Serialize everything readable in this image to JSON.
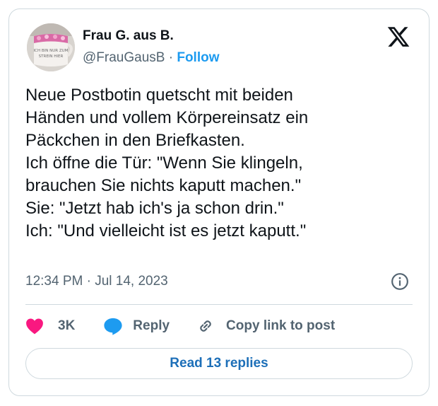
{
  "author": {
    "name": "Frau G. aus B.",
    "handle": "@FrauGausB",
    "separator": "·",
    "follow_label": "Follow",
    "avatar_icon": "avatar-mug-photo",
    "avatar_text": "ICH BIN NUR ZUM\nSTREIN HIER"
  },
  "platform_icon": "x-logo-icon",
  "tweet": {
    "text": "Neue Postbotin quetscht mit beiden\nHänden und vollem Körpereinsatz ein\nPäckchen in den Briefkasten.\nIch öffne die Tür: \"Wenn Sie klingeln,\nbrauchen Sie nichts kaputt machen.\"\nSie: \"Jetzt hab ich's ja schon drin.\"\nIch: \"Und vielleicht ist es jetzt kaputt.\"",
    "timestamp": "12:34 PM · Jul 14, 2023"
  },
  "actions": {
    "like_count": "3K",
    "reply_label": "Reply",
    "copy_label": "Copy link to post"
  },
  "read_replies_label": "Read 13 replies",
  "colors": {
    "accent": "#1d9bf0",
    "like": "#f91880",
    "text": "#0f1419",
    "muted": "#536471",
    "border": "#cfd9de"
  }
}
